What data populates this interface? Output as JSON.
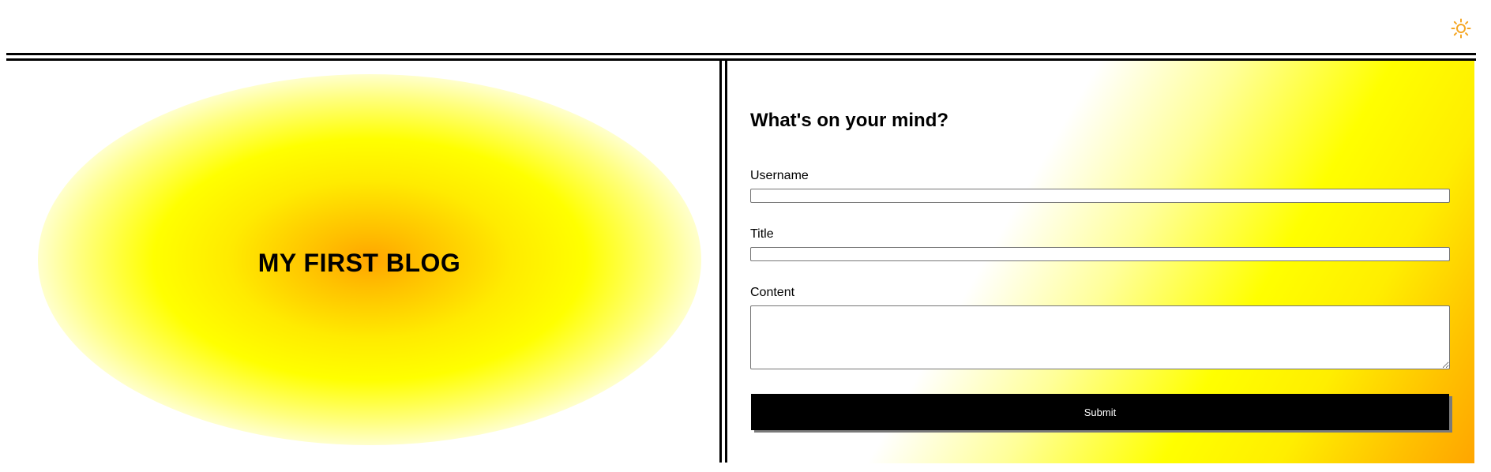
{
  "header": {
    "theme_toggle_icon": "sun-icon",
    "accent_color": "#f5a623"
  },
  "hero": {
    "title": "MY FIRST BLOG"
  },
  "form": {
    "heading": "What's on your mind?",
    "username_label": "Username",
    "username_value": "",
    "title_label": "Title",
    "title_value": "",
    "content_label": "Content",
    "content_value": "",
    "submit_label": "Submit"
  },
  "colors": {
    "gradient_core": "#ffa500",
    "gradient_mid": "#ffff00",
    "button_bg": "#000000",
    "button_text": "#ffffff"
  }
}
